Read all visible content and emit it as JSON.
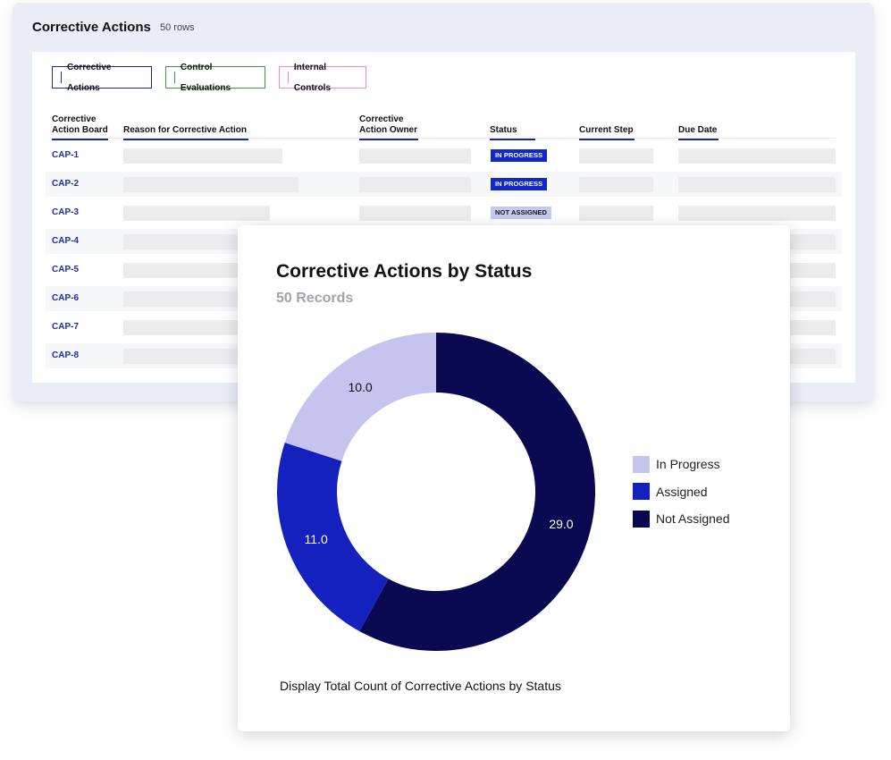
{
  "table_panel": {
    "title": "Corrective Actions",
    "count": "50 rows",
    "tabs": [
      "Corrective Actions",
      "Control Evaluations",
      "Internal Controls"
    ],
    "columns": [
      [
        "Corrective",
        "Action Board"
      ],
      [
        "Reason for Corrective Action"
      ],
      [
        "Corrective",
        "Action Owner"
      ],
      [
        "Status"
      ],
      [
        "Current Step"
      ],
      [
        "Due Date"
      ]
    ],
    "rows": [
      {
        "id": "CAP-1",
        "status": "IN PROGRESS",
        "status_kind": "prog",
        "reason_fill": 0.78
      },
      {
        "id": "CAP-2",
        "status": "IN PROGRESS",
        "status_kind": "prog",
        "reason_fill": 0.86
      },
      {
        "id": "CAP-3",
        "status": "NOT ASSIGNED",
        "status_kind": "none",
        "reason_fill": 0.72
      },
      {
        "id": "CAP-4",
        "status": "",
        "status_kind": "",
        "reason_fill": 1
      },
      {
        "id": "CAP-5",
        "status": "",
        "status_kind": "",
        "reason_fill": 1
      },
      {
        "id": "CAP-6",
        "status": "",
        "status_kind": "",
        "reason_fill": 1
      },
      {
        "id": "CAP-7",
        "status": "",
        "status_kind": "",
        "reason_fill": 1
      },
      {
        "id": "CAP-8",
        "status": "",
        "status_kind": "",
        "reason_fill": 1
      }
    ],
    "colors": {
      "accent": "#1a2fb5",
      "badge_progress": "#1428c8",
      "badge_not_assigned": "#c6c8f0"
    }
  },
  "chart_card": {
    "title": "Corrective Actions by Status",
    "subtitle": "50 Records",
    "footer": "Display Total Count of Corrective Actions by Status"
  },
  "chart_data": {
    "type": "pie",
    "title": "Corrective Actions by Status",
    "subtitle": "50 Records",
    "donut": true,
    "legend_position": "right",
    "categories": [
      "In Progress",
      "Assigned",
      "Not Assigned"
    ],
    "values": [
      10.0,
      11.0,
      29.0
    ],
    "value_labels": [
      "10.0",
      "11.0",
      "29.0"
    ],
    "colors": [
      "#c5c4ee",
      "#1421bf",
      "#0a0850"
    ],
    "label_colors": [
      "#111111",
      "#ffffff",
      "#ffffff"
    ]
  }
}
